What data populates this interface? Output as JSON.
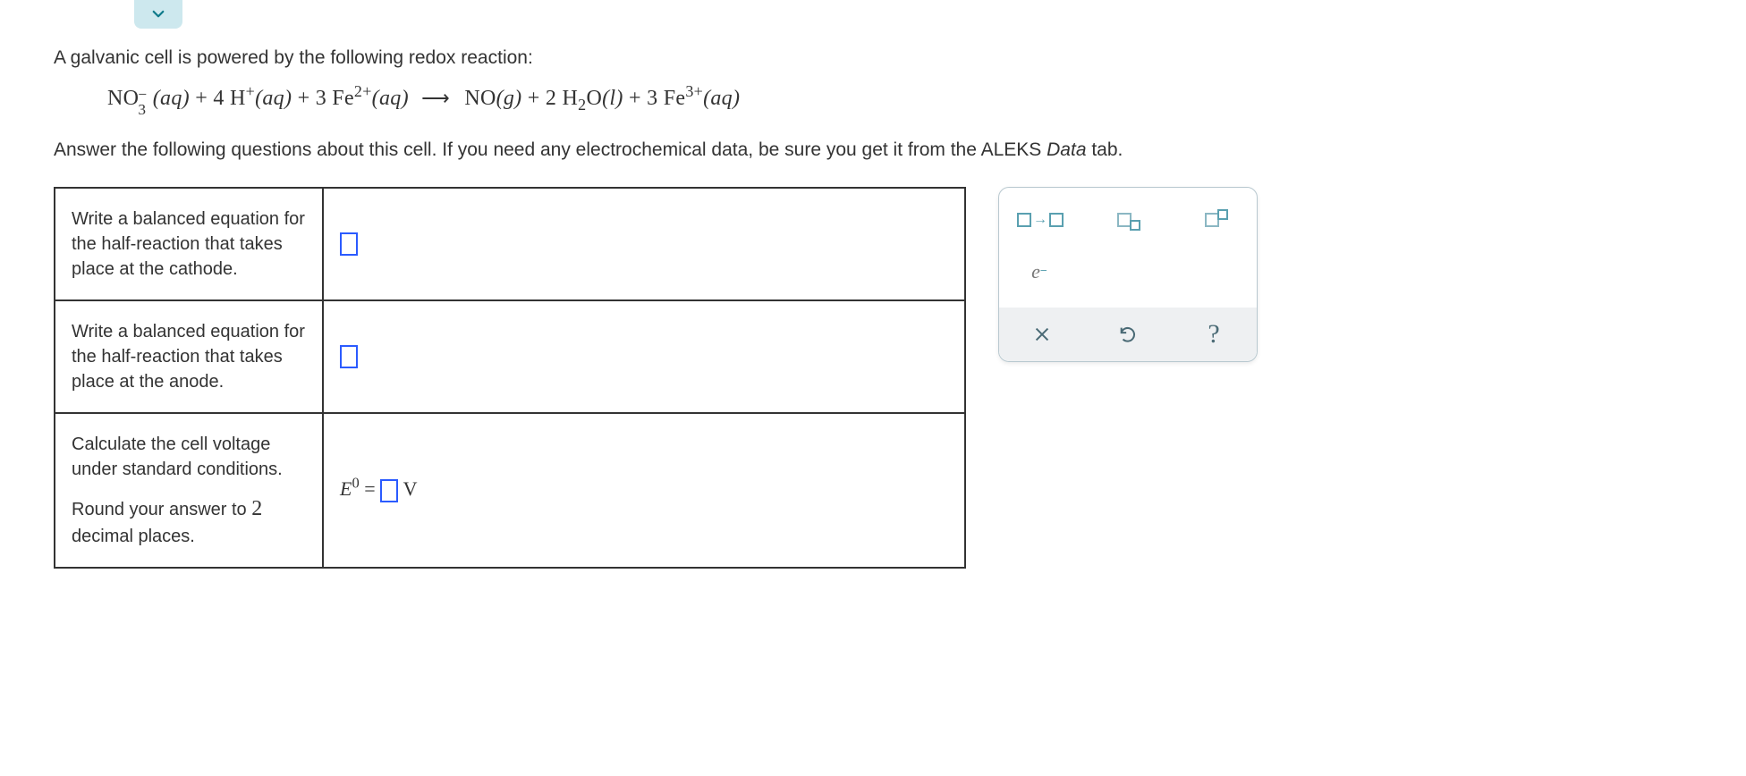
{
  "collapse_tooltip": "Collapse",
  "intro": "A galvanic cell is powered by the following redox reaction:",
  "reaction": {
    "lhs_html": "NO<span class='sub-sup'><span>−</span><span>3</span></span> <span class='italic'>(aq)</span> + 4 H<sup>+</sup><span class='italic'>(aq)</span> + 3 Fe<sup>2+</sup><span class='italic'>(aq)</span>",
    "rhs_html": " NO<span class='italic'>(g)</span> + 2 H<sub>2</sub>O<span class='italic'>(l)</span> + 3 Fe<sup>3+</sup><span class='italic'>(aq)</span>"
  },
  "follow_pre": "Answer the following questions about this cell. If you need any electrochemical data, be sure you get it from the ALEKS ",
  "follow_data": "Data",
  "follow_post": " tab.",
  "q1": "Write a balanced equation for the half-reaction that takes place at the cathode.",
  "q2": "Write a balanced equation for the half-reaction that takes place at the anode.",
  "q3a": "Calculate the cell voltage under standard conditions.",
  "q3b_pre": "Round your answer to ",
  "q3b_num": "2",
  "q3b_post": " decimal places.",
  "evolt_unit": "V",
  "tools": {
    "arrow": "arrow-tool",
    "subscript": "subscript-tool",
    "superscript": "superscript-tool",
    "electron": "electron-tool"
  },
  "actions": {
    "clear": "Clear",
    "undo": "Undo",
    "help": "Help"
  }
}
